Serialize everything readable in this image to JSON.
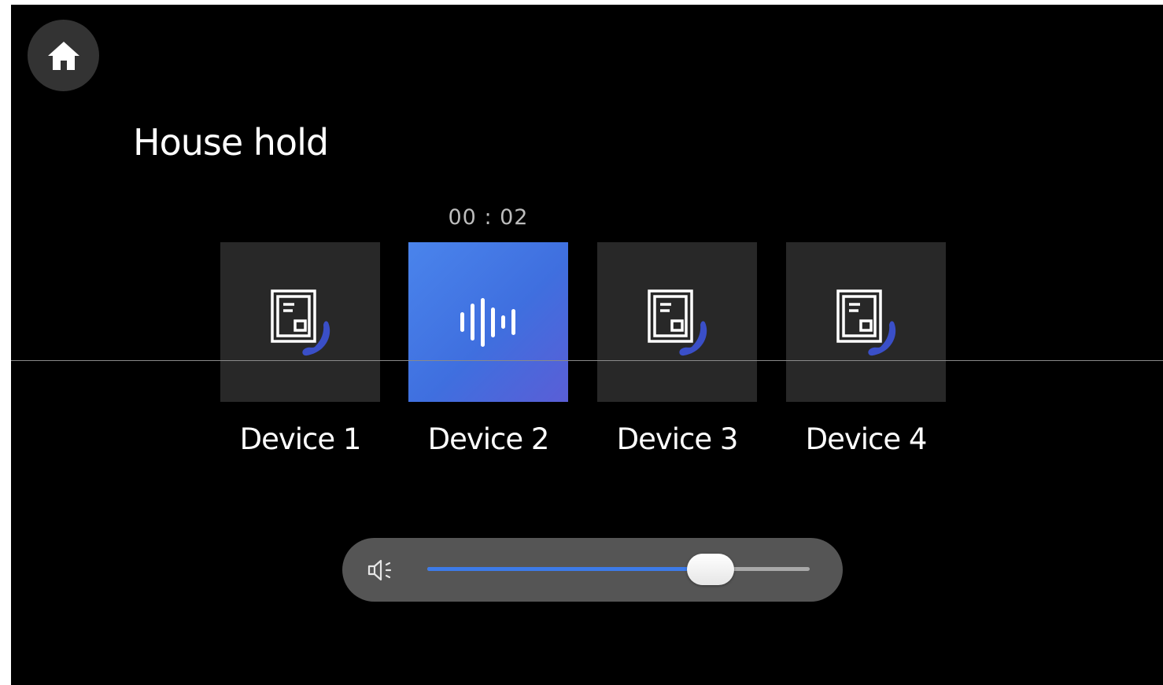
{
  "header": {
    "home_icon": "home-icon",
    "title": "House hold"
  },
  "call": {
    "timer": "00 : 02"
  },
  "devices": [
    {
      "label": "Device 1",
      "icon": "intercom-phone-icon",
      "active": false
    },
    {
      "label": "Device 2",
      "icon": "audio-wave-icon",
      "active": true
    },
    {
      "label": "Device 3",
      "icon": "intercom-phone-icon",
      "active": false
    },
    {
      "label": "Device 4",
      "icon": "intercom-phone-icon",
      "active": false
    }
  ],
  "volume": {
    "icon": "speaker-icon",
    "level": 0.74
  },
  "colors": {
    "background": "#000000",
    "tile": "#282828",
    "active_tile": "#4a7ae6",
    "accent": "#3d7be8",
    "handset": "#3a4fc8"
  }
}
